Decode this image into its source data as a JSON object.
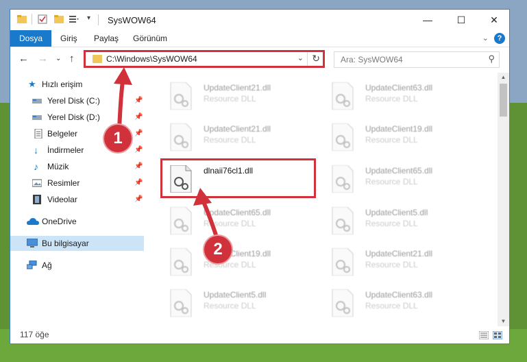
{
  "window": {
    "title": "SysWOW64",
    "minimize_glyph": "—",
    "maximize_glyph": "☐",
    "close_glyph": "✕"
  },
  "ribbon": {
    "tabs": [
      "Dosya",
      "Giriş",
      "Paylaş",
      "Görünüm"
    ],
    "help_glyph": "?"
  },
  "address": {
    "path": "C:\\Windows\\SysWOW64"
  },
  "search": {
    "placeholder": "Ara: SysWOW64"
  },
  "sidebar": {
    "items": [
      {
        "label": "Hızlı erişim",
        "icon": "star-icon",
        "pinned": false
      },
      {
        "label": "Yerel Disk (C:)",
        "icon": "drive-icon",
        "pinned": true
      },
      {
        "label": "Yerel Disk (D:)",
        "icon": "drive-icon",
        "pinned": true
      },
      {
        "label": "Belgeler",
        "icon": "document-icon",
        "pinned": true
      },
      {
        "label": "İndirmeler",
        "icon": "download-icon",
        "pinned": true
      },
      {
        "label": "Müzik",
        "icon": "music-icon",
        "pinned": true
      },
      {
        "label": "Resimler",
        "icon": "pictures-icon",
        "pinned": true
      },
      {
        "label": "Videolar",
        "icon": "video-icon",
        "pinned": true
      },
      {
        "label": "OneDrive",
        "icon": "cloud-icon",
        "pinned": false
      },
      {
        "label": "Bu bilgisayar",
        "icon": "computer-icon",
        "pinned": false,
        "selected": true
      },
      {
        "label": "Ağ",
        "icon": "network-icon",
        "pinned": false
      }
    ]
  },
  "files": [
    {
      "name": "UpdateClient21.dll",
      "desc": "Resource DLL"
    },
    {
      "name": "UpdateClient63.dll",
      "desc": "Resource DLL"
    },
    {
      "name": "UpdateClient21.dll",
      "desc": "Resource DLL"
    },
    {
      "name": "UpdateClient19.dll",
      "desc": "Resource DLL"
    },
    {
      "name": "dlnaii76cl1.dll",
      "desc": ""
    },
    {
      "name": "UpdateClient65.dll",
      "desc": "Resource DLL"
    },
    {
      "name": "UpdateClient65.dll",
      "desc": "Resource DLL"
    },
    {
      "name": "UpdateClient5.dll",
      "desc": "Resource DLL"
    },
    {
      "name": "UpdateClient19.dll",
      "desc": "Resource DLL"
    },
    {
      "name": "UpdateClient21.dll",
      "desc": "Resource DLL"
    },
    {
      "name": "UpdateClient5.dll",
      "desc": "Resource DLL"
    },
    {
      "name": "UpdateClient63.dll",
      "desc": "Resource DLL"
    }
  ],
  "status": {
    "item_count": "117 öğe"
  },
  "annotations": {
    "step1": "1",
    "step2": "2",
    "highlight_color": "#d0313a"
  }
}
